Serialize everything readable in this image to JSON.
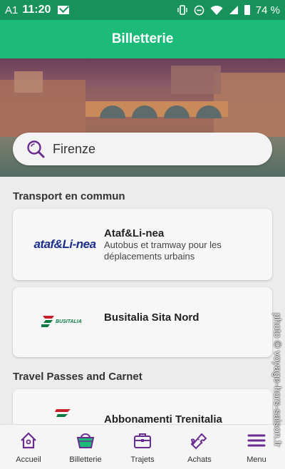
{
  "status_bar": {
    "carrier": "A1",
    "time": "11:20",
    "battery": "74 %"
  },
  "app_bar": {
    "title": "Billetterie"
  },
  "search": {
    "value": "Firenze"
  },
  "sections": [
    {
      "title": "Transport en commun"
    },
    {
      "title": "Travel Passes and Carnet"
    }
  ],
  "cards": [
    {
      "logo_text": "ataf&Li-nea",
      "title": "Ataf&Li-nea",
      "description": "Autobus et tramway pour les déplacements urbains"
    },
    {
      "logo_text": "BUSITALIA",
      "title": "Busitalia Sita Nord",
      "description": ""
    },
    {
      "logo_text": "",
      "title": "Abbonamenti Trenitalia",
      "description": ""
    }
  ],
  "bottom_nav": [
    {
      "label": "Accueil",
      "icon": "home-icon"
    },
    {
      "label": "Billetterie",
      "icon": "basket-icon"
    },
    {
      "label": "Trajets",
      "icon": "briefcase-icon"
    },
    {
      "label": "Achats",
      "icon": "ticket-icon"
    },
    {
      "label": "Menu",
      "icon": "hamburger-icon"
    }
  ],
  "watermark": {
    "text": "photo © voyage-hors-saison.fr"
  },
  "colors": {
    "status_bar": "#17925a",
    "app_bar": "#1dbb7a",
    "accent_purple": "#6a2c8f"
  }
}
